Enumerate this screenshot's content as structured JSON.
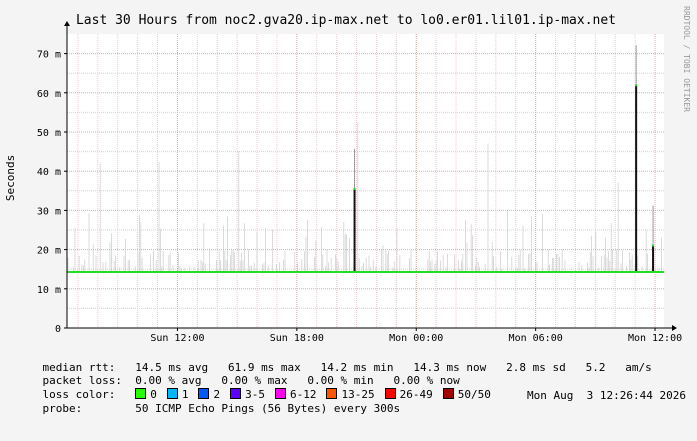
{
  "chart_data": {
    "type": "line",
    "title": "Last 30 Hours from noc2.gva20.ip-max.net to lo0.er01.lil01.ip-max.net",
    "ylabel": "Seconds",
    "side_label": "RRDTOOL / TOBI OETIKER",
    "ylim": [
      0,
      0.075
    ],
    "y_ticks": [
      {
        "value": 0,
        "label": "0"
      },
      {
        "value": 0.01,
        "label": "10 m"
      },
      {
        "value": 0.02,
        "label": "20 m"
      },
      {
        "value": 0.03,
        "label": "30 m"
      },
      {
        "value": 0.04,
        "label": "40 m"
      },
      {
        "value": 0.05,
        "label": "50 m"
      },
      {
        "value": 0.06,
        "label": "60 m"
      },
      {
        "value": 0.07,
        "label": "70 m"
      }
    ],
    "xlim": [
      0,
      30
    ],
    "x_ticks": [
      {
        "value": 5.55,
        "label": "Sun 12:00"
      },
      {
        "value": 11.55,
        "label": "Sun 18:00"
      },
      {
        "value": 17.55,
        "label": "Mon 00:00"
      },
      {
        "value": 23.55,
        "label": "Mon 06:00"
      },
      {
        "value": 29.55,
        "label": "Mon 12:00"
      }
    ],
    "series": [
      {
        "name": "median rtt",
        "color": "#22dd22",
        "x": [
          0,
          14.0,
          14.4,
          28.3,
          28.5,
          28.7,
          30
        ],
        "y": [
          0.0143,
          0.0143,
          0.0143,
          0.0143,
          0.0143,
          0.0143,
          0.0143
        ]
      }
    ],
    "spikes": [
      {
        "x": 14.45,
        "y": 0.0355
      },
      {
        "x": 28.6,
        "y": 0.0619
      },
      {
        "x": 29.45,
        "y": 0.021
      }
    ]
  },
  "stats": {
    "median_label": "median rtt:",
    "median_values": "14.5 ms avg   61.9 ms max   14.2 ms min   14.3 ms now   2.8 ms sd   5.2   am/s",
    "loss_label": "packet loss:",
    "loss_values": "0.00 % avg   0.00 % max   0.00 % min   0.00 % now",
    "color_label": "loss color:",
    "loss_colors": [
      {
        "label": "0",
        "color": "#26ff00"
      },
      {
        "label": "1",
        "color": "#00b8ff"
      },
      {
        "label": "2",
        "color": "#0059ff"
      },
      {
        "label": "3-5",
        "color": "#5e00ff"
      },
      {
        "label": "6-12",
        "color": "#ff00f0"
      },
      {
        "label": "13-25",
        "color": "#ff5500"
      },
      {
        "label": "26-49",
        "color": "#ff0000"
      },
      {
        "label": "50/50",
        "color": "#a00000"
      }
    ],
    "probe_label": "probe:",
    "probe_value": "50 ICMP Echo Pings (56 Bytes) every 300s",
    "timestamp": "Mon Aug  3 12:26:44 2026"
  }
}
